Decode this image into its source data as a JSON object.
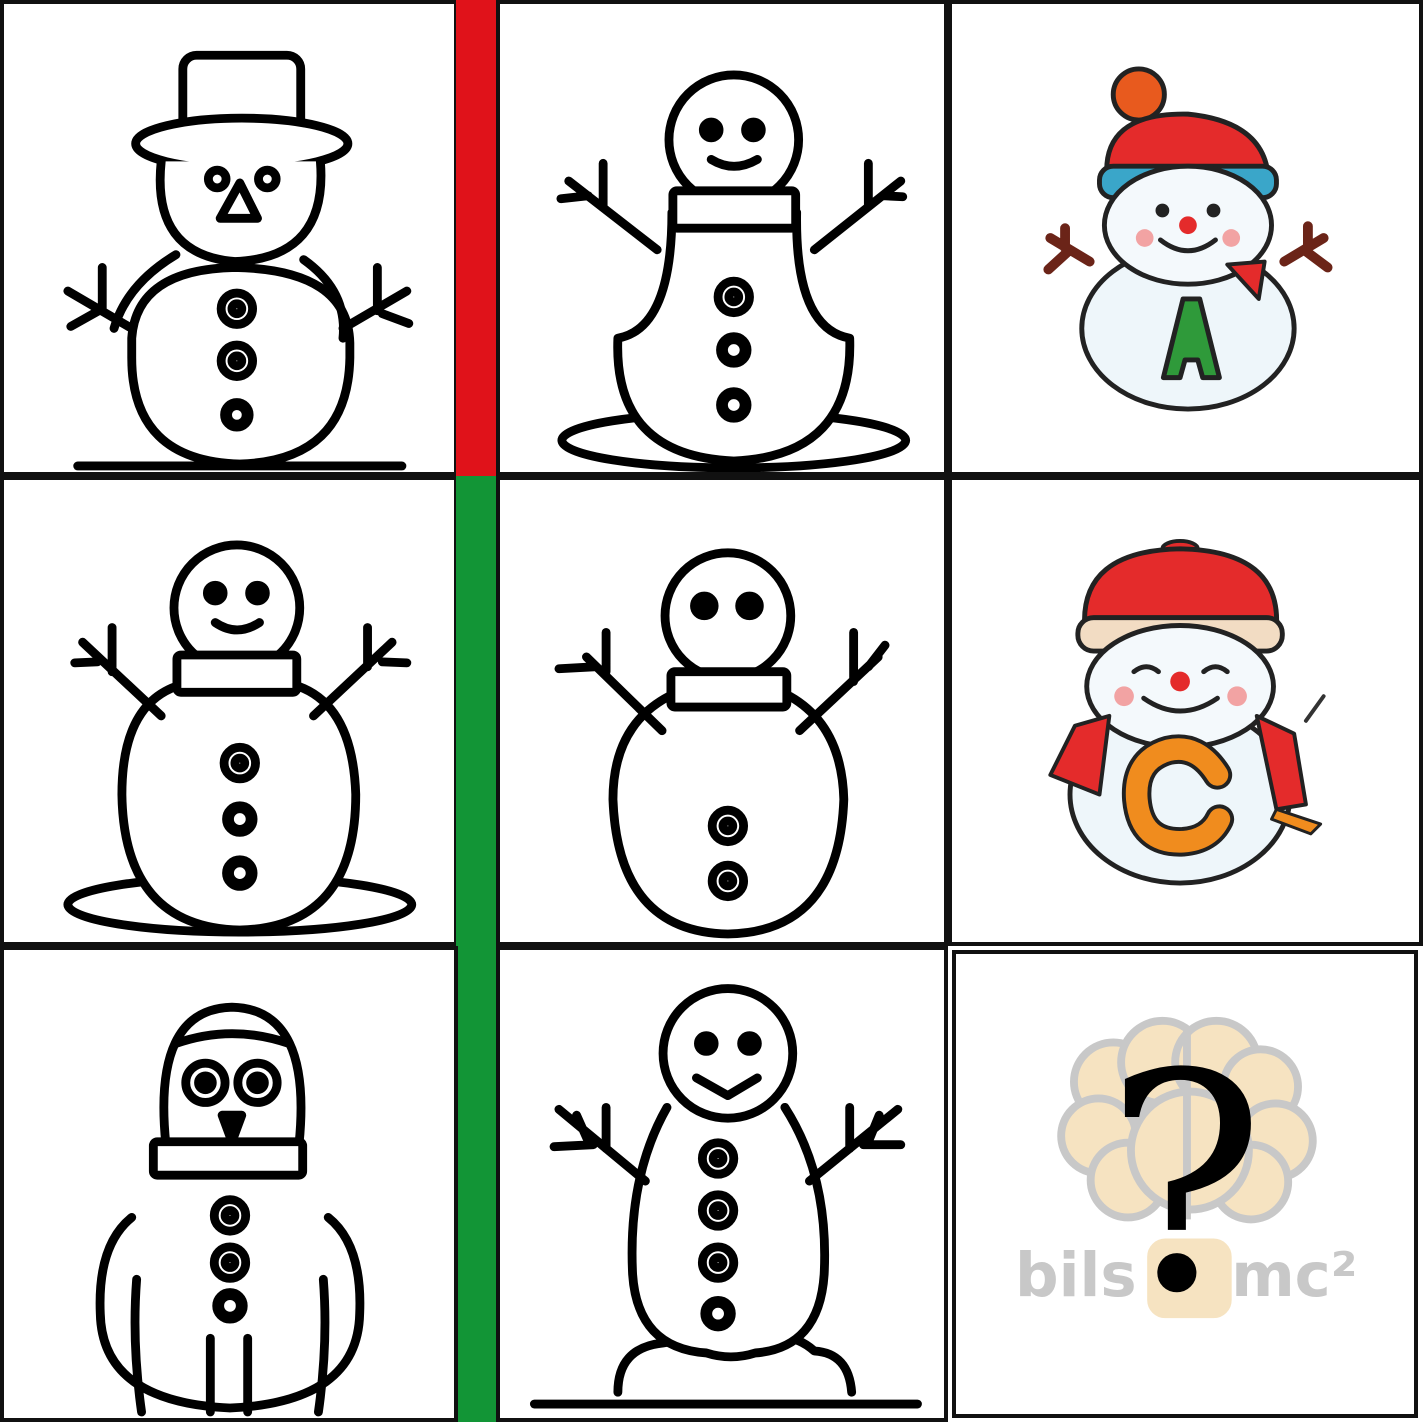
{
  "puzzle": {
    "colors": {
      "line": "#000000",
      "divider_red": "#e0121a",
      "divider_green": "#129536",
      "hat_red": "#e42b2b",
      "hat_blue": "#3aa6c9",
      "letter_green": "#2f9a3a",
      "letter_orange": "#f08c1e",
      "watermark": "#c8c8c8",
      "watermark_brain": "#f6e3c1"
    },
    "cells": [
      {
        "id": "r1c1",
        "icon": "snowman-top-hat-icon"
      },
      {
        "id": "r1c2",
        "icon": "snowman-smile-arms-up-icon"
      },
      {
        "id": "r1c3",
        "icon": "snowman-letter-icon",
        "letter": "A"
      },
      {
        "id": "r2c1",
        "icon": "snowman-smile-ground-icon"
      },
      {
        "id": "r2c2",
        "icon": "snowman-two-eyes-icon"
      },
      {
        "id": "r2c3",
        "icon": "snowman-letter-icon",
        "letter": "C"
      },
      {
        "id": "r3c1",
        "icon": "snowman-owl-face-icon"
      },
      {
        "id": "r3c2",
        "icon": "snowman-tall-icon"
      },
      {
        "id": "r3c3",
        "icon": "question-mark-icon",
        "answer_mark": "?"
      }
    ],
    "watermark": {
      "left": "bils",
      "right": "mc²"
    }
  }
}
